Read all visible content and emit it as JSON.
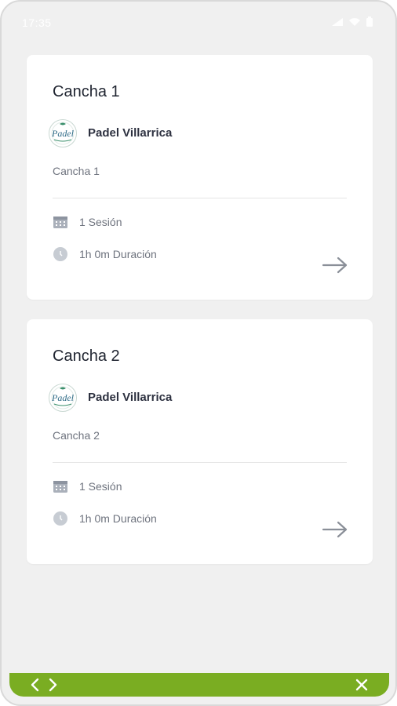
{
  "status_bar": {
    "time": "17:35",
    "icons": [
      "signal-icon",
      "wifi-icon",
      "battery-icon"
    ]
  },
  "cards": [
    {
      "title": "Cancha 1",
      "venue_name": "Padel Villarrica",
      "venue_logo_text": "Padel",
      "subtitle": "Cancha 1",
      "sessions": "1 Sesión",
      "duration": "1h 0m Duración"
    },
    {
      "title": "Cancha 2",
      "venue_name": "Padel Villarrica",
      "venue_logo_text": "Padel",
      "subtitle": "Cancha 2",
      "sessions": "1 Sesión",
      "duration": "1h 0m Duración"
    }
  ],
  "bottom_bar": {
    "icons": [
      "chevron-left-icon",
      "chevron-right-icon",
      "close-icon"
    ]
  },
  "colors": {
    "background": "#f0f0f0",
    "card": "#ffffff",
    "accent_green": "#7aad22",
    "title_text": "#1f2430",
    "muted_text": "#6e737e",
    "logo_green": "#3a8f6b"
  }
}
